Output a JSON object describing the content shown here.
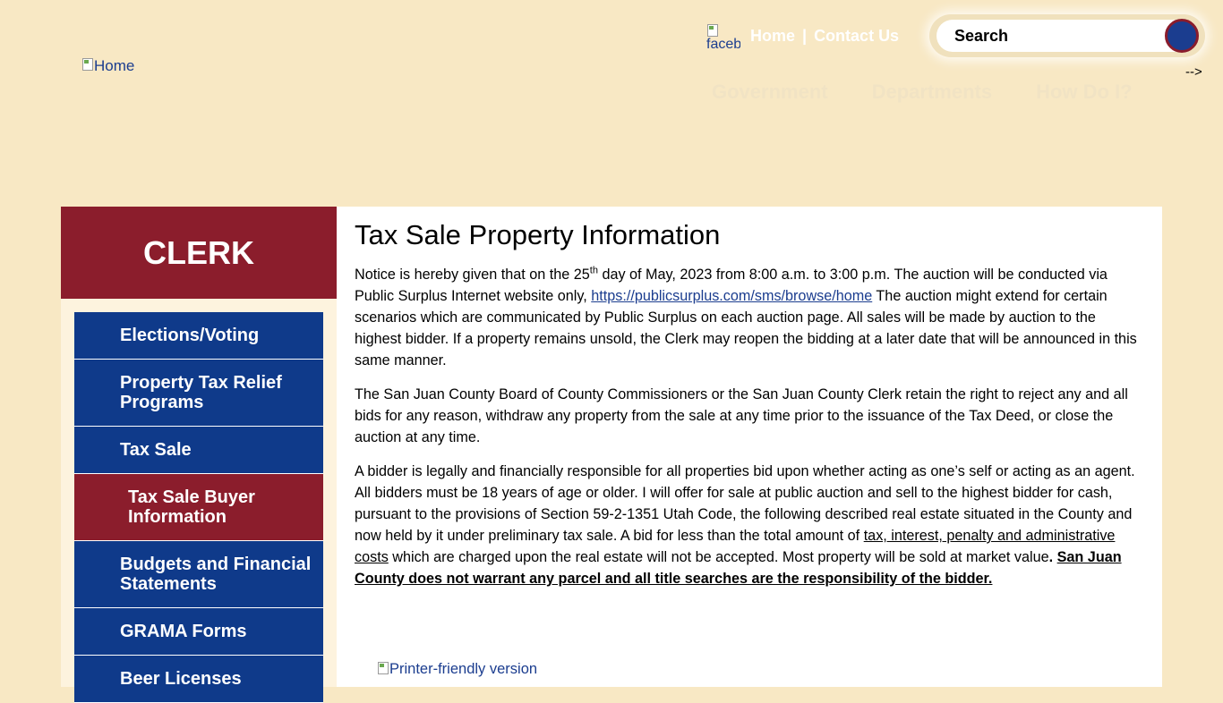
{
  "header": {
    "logo_alt": "Home",
    "facebook_alt": "facebook",
    "top_links": [
      "Home",
      "Contact Us"
    ],
    "top_links_separator": "|",
    "search_placeholder": "Search",
    "arrow_text": "-->",
    "main_nav": [
      "Government",
      "Departments",
      "How Do I?"
    ]
  },
  "sidebar": {
    "title": "CLERK",
    "items": [
      {
        "label": "Elections/Voting",
        "active": false
      },
      {
        "label": "Property Tax Relief Programs",
        "active": false
      },
      {
        "label": "Tax Sale",
        "active": false
      },
      {
        "label": "Tax Sale Buyer Information",
        "active": true
      },
      {
        "label": "Budgets and Financial Statements",
        "active": false
      },
      {
        "label": "GRAMA Forms",
        "active": false
      },
      {
        "label": "Beer Licenses",
        "active": false
      }
    ]
  },
  "content": {
    "title": "Tax Sale Property Information",
    "p1_a": "Notice is hereby given that on the 25",
    "p1_sup": "th",
    "p1_b": " day of May, 2023 from 8:00 a.m. to 3:00 p.m.  The auction will be conducted via Public Surplus Internet website only, ",
    "p1_link": "https://publicsurplus.com/sms/browse/home",
    "p1_c": " The auction might extend for certain scenarios which are communicated by Public Surplus on each auction page. All sales will be made by auction to the highest bidder. If a property remains unsold, the Clerk may reopen the bidding at a later date that will be announced in this same manner.",
    "p2": "The San Juan County Board of County Commissioners or the San Juan County Clerk retain the right to reject any and all bids for any reason, withdraw any property from the sale at any time prior to the issuance of the Tax Deed, or close the auction at any time.",
    "p3_a": "A bidder is legally and financially responsible for all properties bid upon whether acting as one’s self or acting as an agent. All bidders must be 18 years of age or older. I will offer for sale at public auction and sell to the highest bidder for cash, pursuant to the provisions of Section 59-2-1351 Utah Code, the following described real estate situated in the County and now held by it under preliminary tax sale.  A bid for less than the total amount of ",
    "p3_underline": "tax, interest, penalty and administrative costs",
    "p3_b": " which are charged upon the real estate will not be accepted.  Most property will be sold at market value",
    "p3_period": ".  ",
    "p3_bold": "San Juan County does not warrant any parcel and all title searches are the responsibility of the bidder.",
    "printer_alt": "Printer-friendly version"
  }
}
